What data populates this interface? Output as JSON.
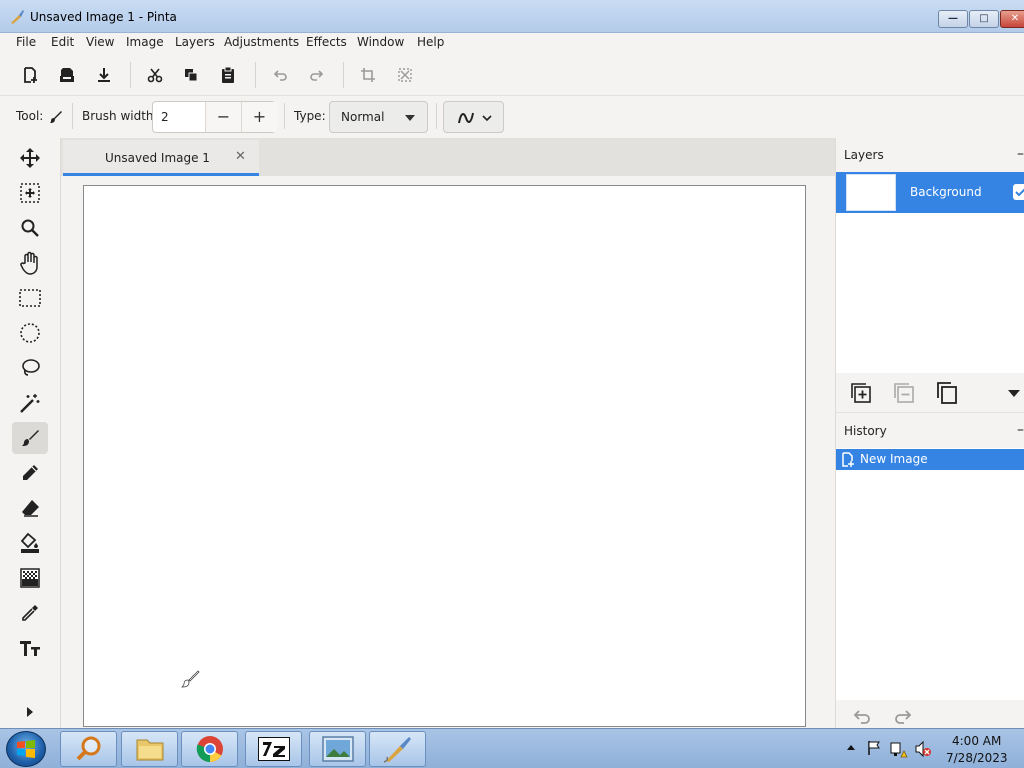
{
  "window": {
    "title": "Unsaved Image 1 - Pinta"
  },
  "menu": [
    "File",
    "Edit",
    "View",
    "Image",
    "Layers",
    "Adjustments",
    "Effects",
    "Window",
    "Help"
  ],
  "toolbar2": {
    "tool_label": "Tool:",
    "brush_width_label": "Brush width:",
    "brush_width_value": "2",
    "type_label": "Type:",
    "type_value": "Normal"
  },
  "document": {
    "tab_title": "Unsaved Image 1"
  },
  "layers": {
    "header": "Layers",
    "items": [
      {
        "name": "Background",
        "visible": true
      }
    ]
  },
  "history": {
    "header": "History",
    "items": [
      {
        "label": "New Image"
      }
    ]
  },
  "taskbar": {
    "time": "4:00 AM",
    "date": "7/28/2023"
  },
  "colors": {
    "accent": "#3584e4"
  }
}
